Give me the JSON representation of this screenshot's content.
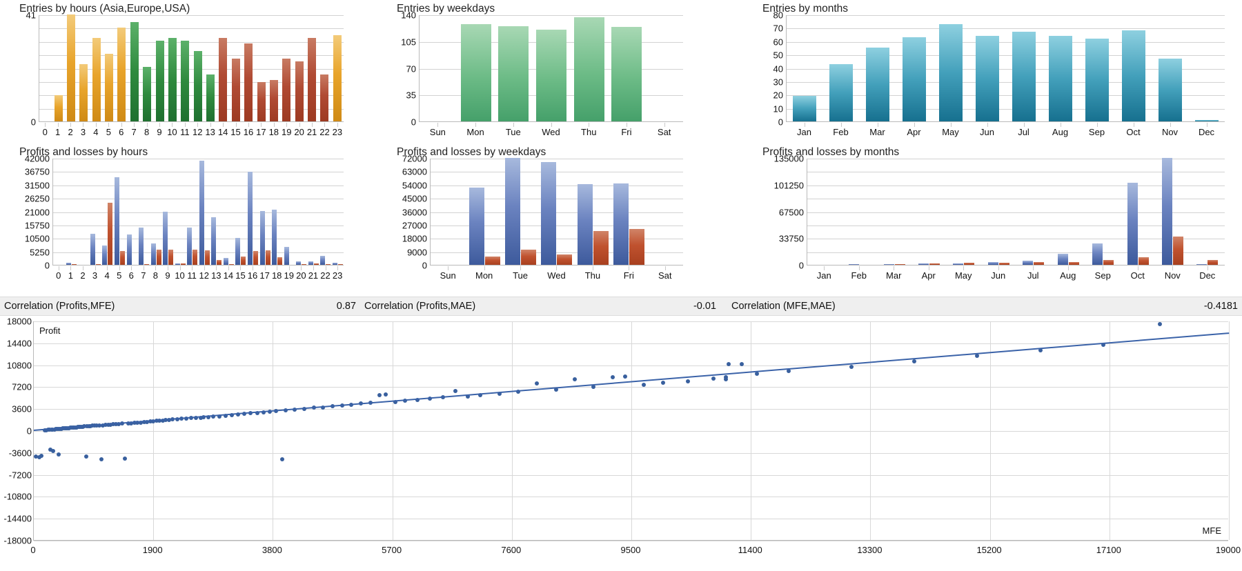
{
  "charts": {
    "entries_hours": {
      "title": "Entries by hours (Asia,Europe,USA)",
      "ymax_label": "41",
      "ymin_label": "0"
    },
    "entries_weekdays": {
      "title": "Entries by weekdays"
    },
    "entries_months": {
      "title": "Entries by months"
    },
    "pl_hours": {
      "title": "Profits and losses by hours"
    },
    "pl_weekdays": {
      "title": "Profits and losses by weekdays"
    },
    "pl_months": {
      "title": "Profits and losses by months"
    }
  },
  "correlations": [
    {
      "label": "Correlation (Profits,MFE)",
      "value": "0.87"
    },
    {
      "label": "Correlation (Profits,MAE)",
      "value": "-0.01"
    },
    {
      "label": "Correlation (MFE,MAE)",
      "value": "-0.4181"
    }
  ],
  "scatter_axis": {
    "y_title": "Profit",
    "x_title": "MFE"
  },
  "chart_data": [
    {
      "id": "entries_by_hours",
      "type": "bar",
      "title": "Entries by hours (Asia,Europe,USA)",
      "xlabel": "",
      "ylabel": "",
      "ylim": [
        0,
        41
      ],
      "yticks": [
        0,
        41
      ],
      "grid": true,
      "categories": [
        "0",
        "1",
        "2",
        "3",
        "4",
        "5",
        "6",
        "7",
        "8",
        "9",
        "10",
        "11",
        "12",
        "13",
        "14",
        "15",
        "16",
        "17",
        "18",
        "19",
        "20",
        "21",
        "22",
        "23"
      ],
      "values": [
        0,
        10,
        41,
        22,
        32,
        26,
        36,
        38,
        21,
        31,
        32,
        31,
        27,
        18,
        32,
        24,
        30,
        15,
        16,
        24,
        23,
        32,
        18,
        33
      ],
      "colors": [
        "#cf8a15",
        "#cf8a15",
        "#cf8a15",
        "#cf8a15",
        "#cf8a15",
        "#cf8a15",
        "#cf8a15",
        "#2f8a3e",
        "#2f8a3e",
        "#2f8a3e",
        "#2f8a3e",
        "#2f8a3e",
        "#2f8a3e",
        "#2f8a3e",
        "#b04a33",
        "#b04a33",
        "#b04a33",
        "#b04a33",
        "#b04a33",
        "#b04a33",
        "#b04a33",
        "#b04a33",
        "#b04a33",
        "#cf8a15"
      ],
      "session_groups": [
        "Asia",
        "Europe",
        "USA"
      ]
    },
    {
      "id": "entries_by_weekdays",
      "type": "bar",
      "title": "Entries by weekdays",
      "ylim": [
        0,
        140
      ],
      "yticks": [
        0,
        35,
        70,
        105,
        140
      ],
      "grid": true,
      "categories": [
        "Sun",
        "Mon",
        "Tue",
        "Wed",
        "Thu",
        "Fri",
        "Sat"
      ],
      "values": [
        0,
        127,
        125,
        120,
        136,
        124,
        0
      ],
      "color": "#45a06a"
    },
    {
      "id": "entries_by_months",
      "type": "bar",
      "title": "Entries by months",
      "ylim": [
        0,
        80
      ],
      "yticks": [
        0,
        10,
        20,
        30,
        40,
        50,
        60,
        70,
        80
      ],
      "grid": true,
      "categories": [
        "Jan",
        "Feb",
        "Mar",
        "Apr",
        "May",
        "Jun",
        "Jul",
        "Aug",
        "Sep",
        "Oct",
        "Nov",
        "Dec"
      ],
      "values": [
        19,
        43,
        55,
        63,
        73,
        64,
        67,
        64,
        62,
        68,
        47,
        1
      ],
      "color": "#16708f"
    },
    {
      "id": "profits_losses_by_hours",
      "type": "bar",
      "title": "Profits and losses by hours",
      "ylim": [
        0,
        42000
      ],
      "yticks": [
        0,
        5250,
        10500,
        15750,
        21000,
        26250,
        31500,
        36750,
        42000
      ],
      "grid": true,
      "categories": [
        "0",
        "1",
        "2",
        "3",
        "4",
        "5",
        "6",
        "7",
        "8",
        "9",
        "10",
        "11",
        "12",
        "13",
        "14",
        "15",
        "16",
        "17",
        "18",
        "19",
        "20",
        "21",
        "22",
        "23"
      ],
      "series": [
        {
          "name": "Profits",
          "color": "#3d5a9c",
          "values": [
            0,
            900,
            0,
            12300,
            7500,
            34300,
            11900,
            14600,
            8300,
            21000,
            600,
            14700,
            41000,
            18700,
            2700,
            10600,
            36700,
            21100,
            21800,
            7000,
            1400,
            1300,
            3400,
            700,
            3600
          ]
        },
        {
          "name": "Losses",
          "color": "#a8401f",
          "values": [
            0,
            400,
            0,
            200,
            24300,
            5400,
            100,
            300,
            6000,
            5900,
            500,
            6100,
            5700,
            1900,
            200,
            3200,
            5400,
            5800,
            2900,
            100,
            300,
            500,
            400,
            200
          ]
        }
      ]
    },
    {
      "id": "profits_losses_by_weekdays",
      "type": "bar",
      "title": "Profits and losses by weekdays",
      "ylim": [
        0,
        72000
      ],
      "yticks": [
        0,
        9000,
        18000,
        27000,
        36000,
        45000,
        54000,
        63000,
        72000
      ],
      "grid": true,
      "categories": [
        "Sun",
        "Mon",
        "Tue",
        "Wed",
        "Thu",
        "Fri",
        "Sat"
      ],
      "series": [
        {
          "name": "Profits",
          "color": "#3d5a9c",
          "values": [
            0,
            52000,
            72000,
            69000,
            54200,
            54700,
            0
          ]
        },
        {
          "name": "Losses",
          "color": "#a8401f",
          "values": [
            0,
            5400,
            10000,
            7000,
            23000,
            24300,
            0
          ]
        }
      ]
    },
    {
      "id": "profits_losses_by_months",
      "type": "bar",
      "title": "Profits and losses by months",
      "ylim": [
        0,
        135000
      ],
      "yticks": [
        0,
        33750,
        67500,
        101250,
        135000
      ],
      "grid": true,
      "categories": [
        "Jan",
        "Feb",
        "Mar",
        "Apr",
        "May",
        "Jun",
        "Jul",
        "Aug",
        "Sep",
        "Oct",
        "Nov",
        "Dec"
      ],
      "series": [
        {
          "name": "Profits",
          "color": "#3d5a9c",
          "values": [
            400,
            600,
            700,
            1500,
            2000,
            3600,
            5400,
            14000,
            27000,
            104000,
            135000,
            1200
          ]
        },
        {
          "name": "Losses",
          "color": "#a8401f",
          "values": [
            300,
            400,
            500,
            1800,
            2600,
            2900,
            3400,
            3600,
            6200,
            9300,
            36000,
            6000
          ]
        }
      ]
    },
    {
      "id": "profit_vs_mfe_scatter",
      "type": "scatter",
      "title": "",
      "xlabel": "MFE",
      "ylabel": "Profit",
      "xlim": [
        0,
        19000
      ],
      "ylim": [
        -18000,
        18000
      ],
      "xticks": [
        0,
        1900,
        3800,
        5700,
        7600,
        9500,
        11400,
        13300,
        15200,
        17100,
        19000
      ],
      "yticks": [
        -18000,
        -14400,
        -10800,
        -7200,
        -3600,
        0,
        3600,
        7200,
        10800,
        14400,
        18000
      ],
      "grid": true,
      "trendline": {
        "x0": 0,
        "y0": 250,
        "x1": 19000,
        "y1": 16200,
        "color": "#3a62a8"
      },
      "point_color": "#39609e",
      "points": [
        [
          30,
          -4200
        ],
        [
          90,
          -4300
        ],
        [
          120,
          -4100
        ],
        [
          180,
          150
        ],
        [
          200,
          120
        ],
        [
          230,
          180
        ],
        [
          250,
          200
        ],
        [
          260,
          -3000
        ],
        [
          280,
          230
        ],
        [
          300,
          260
        ],
        [
          310,
          -3300
        ],
        [
          330,
          280
        ],
        [
          350,
          300
        ],
        [
          370,
          320
        ],
        [
          390,
          -3900
        ],
        [
          400,
          340
        ],
        [
          420,
          360
        ],
        [
          440,
          380
        ],
        [
          460,
          400
        ],
        [
          480,
          420
        ],
        [
          500,
          440
        ],
        [
          520,
          460
        ],
        [
          540,
          480
        ],
        [
          560,
          500
        ],
        [
          580,
          520
        ],
        [
          600,
          540
        ],
        [
          620,
          560
        ],
        [
          640,
          580
        ],
        [
          660,
          600
        ],
        [
          680,
          620
        ],
        [
          700,
          640
        ],
        [
          720,
          660
        ],
        [
          740,
          680
        ],
        [
          760,
          700
        ],
        [
          780,
          720
        ],
        [
          800,
          740
        ],
        [
          830,
          -4200
        ],
        [
          850,
          780
        ],
        [
          880,
          800
        ],
        [
          900,
          820
        ],
        [
          930,
          850
        ],
        [
          960,
          880
        ],
        [
          1000,
          900
        ],
        [
          1040,
          930
        ],
        [
          1080,
          -4600
        ],
        [
          1100,
          960
        ],
        [
          1140,
          990
        ],
        [
          1180,
          1020
        ],
        [
          1220,
          1050
        ],
        [
          1260,
          1080
        ],
        [
          1300,
          1100
        ],
        [
          1350,
          1150
        ],
        [
          1400,
          1200
        ],
        [
          1450,
          -4500
        ],
        [
          1500,
          1250
        ],
        [
          1550,
          1300
        ],
        [
          1600,
          1350
        ],
        [
          1650,
          1380
        ],
        [
          1700,
          1400
        ],
        [
          1750,
          1450
        ],
        [
          1800,
          1500
        ],
        [
          1850,
          1550
        ],
        [
          1900,
          1600
        ],
        [
          1950,
          1650
        ],
        [
          2000,
          1700
        ],
        [
          2050,
          1750
        ],
        [
          2100,
          1800
        ],
        [
          2150,
          1850
        ],
        [
          2200,
          1900
        ],
        [
          2280,
          1950
        ],
        [
          2350,
          2000
        ],
        [
          2420,
          2050
        ],
        [
          2500,
          2100
        ],
        [
          2580,
          2150
        ],
        [
          2650,
          2200
        ],
        [
          2700,
          2250
        ],
        [
          2780,
          2300
        ],
        [
          2850,
          2350
        ],
        [
          2950,
          2400
        ],
        [
          3050,
          2500
        ],
        [
          3150,
          2600
        ],
        [
          3250,
          2700
        ],
        [
          3350,
          2800
        ],
        [
          3450,
          2900
        ],
        [
          3550,
          3000
        ],
        [
          3650,
          3100
        ],
        [
          3750,
          3200
        ],
        [
          3850,
          3300
        ],
        [
          3950,
          -4600
        ],
        [
          4000,
          3400
        ],
        [
          4150,
          3500
        ],
        [
          4300,
          3650
        ],
        [
          4450,
          3800
        ],
        [
          4600,
          3900
        ],
        [
          4750,
          4050
        ],
        [
          4900,
          4200
        ],
        [
          5050,
          4350
        ],
        [
          5200,
          4500
        ],
        [
          5350,
          4650
        ],
        [
          5500,
          5900
        ],
        [
          5600,
          5950
        ],
        [
          5750,
          4800
        ],
        [
          5900,
          4950
        ],
        [
          6100,
          5100
        ],
        [
          6300,
          5300
        ],
        [
          6500,
          5500
        ],
        [
          6700,
          6600
        ],
        [
          6900,
          5700
        ],
        [
          7100,
          5900
        ],
        [
          7400,
          6100
        ],
        [
          7700,
          6400
        ],
        [
          8000,
          7800
        ],
        [
          8300,
          6800
        ],
        [
          8600,
          8500
        ],
        [
          8900,
          7300
        ],
        [
          9200,
          8800
        ],
        [
          9400,
          9000
        ],
        [
          9700,
          7600
        ],
        [
          10000,
          7900
        ],
        [
          10400,
          8200
        ],
        [
          10800,
          8600
        ],
        [
          11000,
          8800
        ],
        [
          11050,
          11000
        ],
        [
          11250,
          11000
        ],
        [
          11000,
          8500
        ],
        [
          11500,
          9400
        ],
        [
          12000,
          9800
        ],
        [
          13000,
          10500
        ],
        [
          14000,
          11400
        ],
        [
          15000,
          12300
        ],
        [
          16000,
          13300
        ],
        [
          17000,
          14200
        ],
        [
          17900,
          17600
        ]
      ]
    }
  ]
}
